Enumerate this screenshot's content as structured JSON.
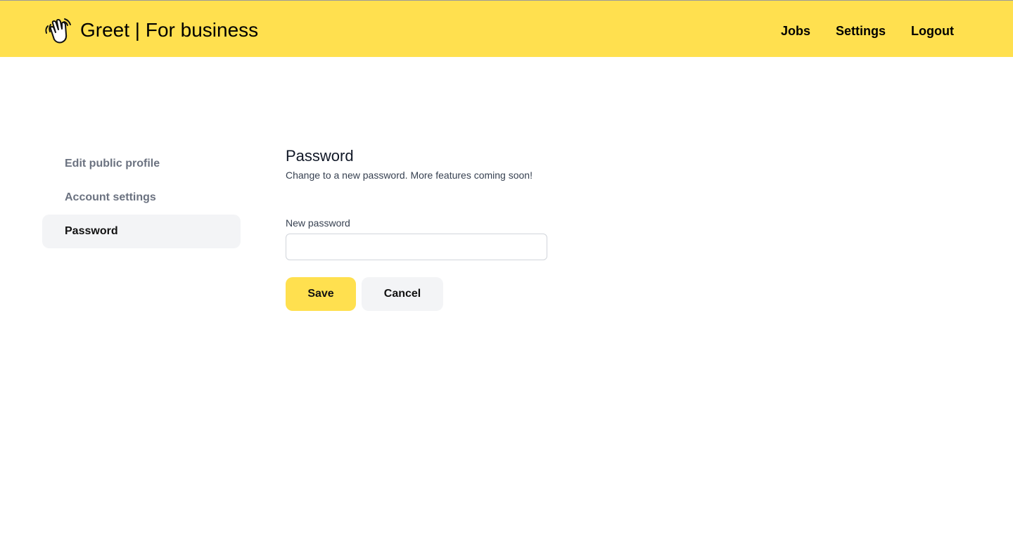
{
  "header": {
    "brand_title": "Greet | For business",
    "logo_icon": "waving-hand-icon",
    "background": "#FFE04F",
    "nav": [
      {
        "label": "Jobs"
      },
      {
        "label": "Settings"
      },
      {
        "label": "Logout"
      }
    ]
  },
  "sidebar": {
    "items": [
      {
        "label": "Edit public profile",
        "active": false
      },
      {
        "label": "Account settings",
        "active": false
      },
      {
        "label": "Password",
        "active": true
      }
    ]
  },
  "main": {
    "title": "Password",
    "subtitle": "Change to a new password. More features coming soon!",
    "new_password": {
      "label": "New password",
      "value": "",
      "placeholder": ""
    },
    "save_label": "Save",
    "cancel_label": "Cancel"
  },
  "colors": {
    "accent": "#FFE04F",
    "muted_bg": "#f3f4f6",
    "muted_text": "#6b7280"
  }
}
